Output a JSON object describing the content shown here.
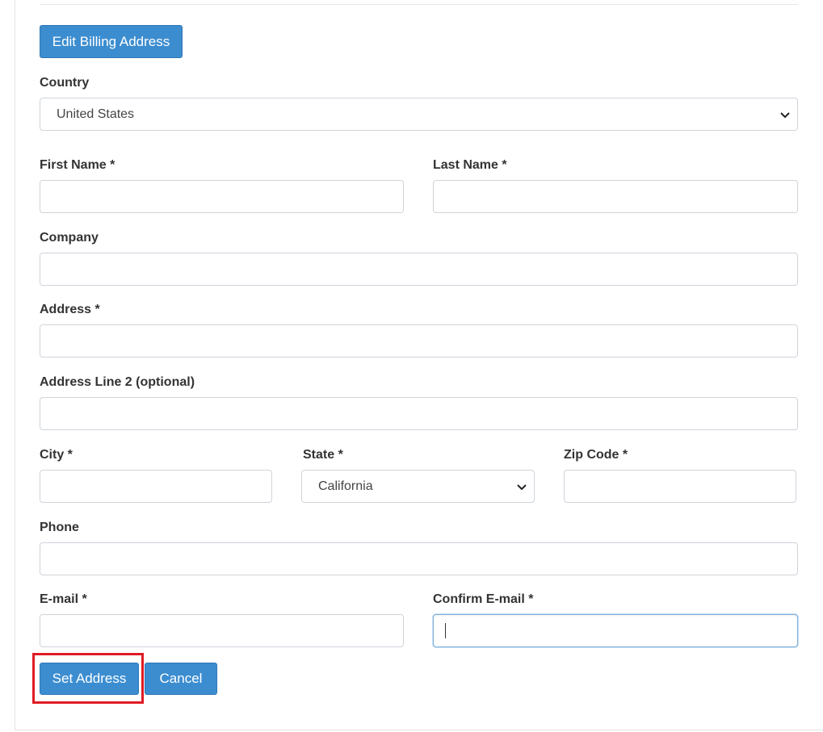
{
  "header": {
    "edit_billing_label": "Edit Billing Address"
  },
  "form": {
    "country": {
      "label": "Country",
      "value": "United States"
    },
    "first_name": {
      "label": "First Name *",
      "value": ""
    },
    "last_name": {
      "label": "Last Name *",
      "value": ""
    },
    "company": {
      "label": "Company",
      "value": ""
    },
    "address": {
      "label": "Address *",
      "value": ""
    },
    "address2": {
      "label": "Address Line 2 (optional)",
      "value": ""
    },
    "city": {
      "label": "City *",
      "value": ""
    },
    "state": {
      "label": "State *",
      "value": "California"
    },
    "zip": {
      "label": "Zip Code *",
      "value": ""
    },
    "phone": {
      "label": "Phone",
      "value": ""
    },
    "email": {
      "label": "E-mail *",
      "value": ""
    },
    "confirm_email": {
      "label": "Confirm E-mail *",
      "value": ""
    }
  },
  "actions": {
    "set_address_label": "Set Address",
    "cancel_label": "Cancel"
  },
  "colors": {
    "primary_button": "#3c8dd0",
    "highlight": "#e01b24"
  }
}
